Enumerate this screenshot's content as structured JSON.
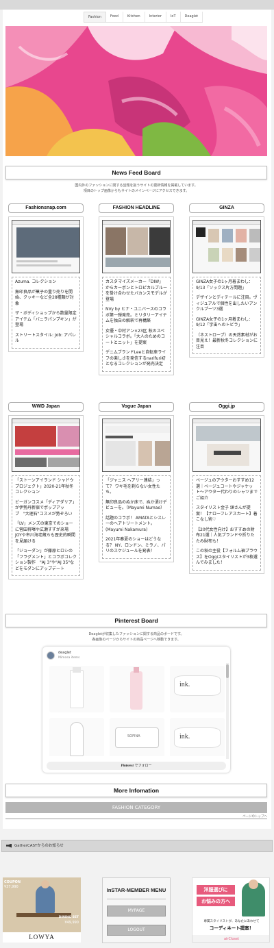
{
  "nav": {
    "tabs": [
      "Fashion",
      "Food",
      "Kitchen",
      "Interior",
      "IoT",
      "Deaglet"
    ]
  },
  "news_feed": {
    "title": "News Feed Board",
    "desc_line1": "国内外のファッションに関する話題を扱うサイトの更新情報を掲載しています。",
    "desc_line2": "項目のトップ画像からもサイトのメインページにアクセスできます。",
    "sources": [
      {
        "name": "Fashionsnap.com",
        "articles": [
          "Azuma. コレクション",
          "無印良品が菓子の量り売りを開始、クッキーなど全28種類が対象",
          "ザ・ボディショップから数量限定アイテム「バニラパンプキン」が登場",
          "ストリートスタイル: Job: アパレル"
        ]
      },
      {
        "name": "FASHION HEADLINE",
        "articles": [
          "カスタマイズメーカー「DIW」からカーボンとトロピカルブルーを掛け合わせたバカンスモデルが登場",
          "NVy by ヒナ・ユニバースのコラボ第一弾発売。ミリタリーアイテムを独自の解釈で再構築",
          "女優・中村アン×23区 秋のスペシャルコラボ。「大人のためのコートとニット」を提案",
          "デニムブランドLeeと自転車ライフの楽しさを発信するnarifuri初となるコレクションが発売決定"
        ]
      },
      {
        "name": "GINZA",
        "articles": [
          "GINZA女子の1ヶ月着まわし：9/13「ソックス片方問題」",
          "デザインとディテールに注目。ヴィジュアルで個性を出したいアンクルブーツ3選",
          "GINZA女子の1ヶ月着まわし：9/12「宇宙へのトビラ」",
          "（ネストローブ）の天然素材がお目見え！最新秋冬コレクションに注目"
        ]
      },
      {
        "name": "WWD Japan",
        "articles": [
          "「ストーンアイランド シャドウプロジェクト」2020-21年秋冬コレクション",
          "ビーガンコスメ「ディアダリア」が伊勢丹新宿でポップアップ　\"大理石\"コスメが勢ぞろい",
          "「LV」メンズの東京でのショーに菅田将暉や広瀬すずが来場　JOYや市川海老蔵らも歴史的瞬間を見届ける",
          "「ジョーダン」が藤原ヒロシの「フラグメント」とコラボコレクション製作　\"AJ 3\"や\"AJ 35\"などをモダンにアップデート"
        ]
      },
      {
        "name": "Vogue Japan",
        "articles": [
          "「ジャニス ヘアリー連結」って？ ワキ毛を剃らない女性たち。",
          "無印良品のぬか床で、ぬか漬けデビューを。（Mayumi Numao）",
          "話題のコラボ！ AMATAとシスレーのヘアトリートメント。(Mayumi Nakamura)",
          "2021年春夏のショーはどうなる？ NY、ロンドン、ミラノ、パリのスケジュールを発表！"
        ]
      },
      {
        "name": "Oggi.jp",
        "articles": [
          "ベージュのアウターおすすめ12選｜ベージュコートやジャケット〜アウター代わりのシャツまでご紹介",
          "スタイリスト金子 頌さんが提案！【ナローフレアスカート】着こなし術♡",
          "【20代女性向け】おすすめの財布21選｜人気ブランドや折りたたみ財布も！",
          "この秋の主役【フォルム袖ブラウス】をOggiスタイリストが3枚選んでみました！"
        ]
      }
    ]
  },
  "pinterest": {
    "title": "Pinterest Board",
    "desc_line1": "Deagletが収集したファッションに関する商品のボードです。",
    "desc_line2": "各画像のページからサイトの商品ページへ移動できます。",
    "user": "deaglet",
    "board": "Mimosa items",
    "follow": "でフォロー",
    "brand": "Pinterest"
  },
  "more_info": {
    "title": "More Infomation",
    "fashion_category": "FASHION CATEGORY",
    "page_top": "ページのトップへ"
  },
  "notice": "GatherCASTからのお知らせ",
  "member": {
    "title": "InSTAR-MEMBER MENU",
    "mypage": "MYPAGE",
    "logout": "LOGOUT"
  },
  "ads": {
    "left_brand": "LOWYA",
    "left_coupon": "COUPON",
    "left_price": "¥37,990",
    "left_set": "DINING SET",
    "left_set_price": "¥49,990",
    "right_head1": "洋服選びに",
    "right_head2": "お悩みの方へ",
    "right_caption1": "専属スタイリストが、あなたにあわせて",
    "right_caption2": "コーディネート提案！",
    "right_brand": "airCloset"
  },
  "colors": {
    "accent_grey": "#b5b5b5",
    "page_bg": "#f2f2f2"
  }
}
